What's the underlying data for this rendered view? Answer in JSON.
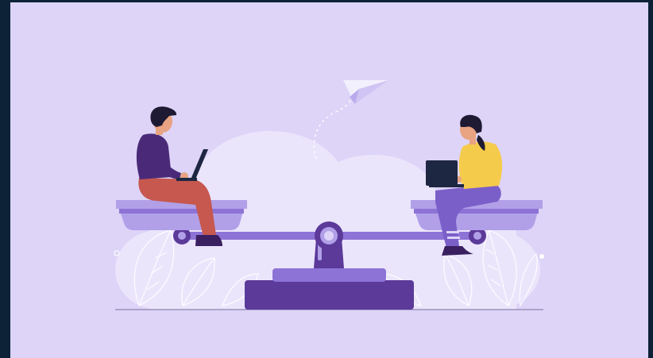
{
  "illustration": {
    "subject": "work-life-balance",
    "colors": {
      "background": "#ddd4f8",
      "frame": "#0d2137",
      "cloud": "#ebe5fc",
      "seesaw_light": "#b1a0e8",
      "seesaw_mid": "#8d73d6",
      "seesaw_dark": "#5b3a9a",
      "man_shirt": "#4a2a78",
      "man_pants": "#c6584f",
      "woman_shirt": "#f5cb4c",
      "woman_pants": "#7b5fc9",
      "hair": "#1f1a33",
      "skin": "#e8a382",
      "laptop": "#1e2742"
    },
    "icons": [
      "paper-plane-icon",
      "leaf-icon"
    ]
  }
}
